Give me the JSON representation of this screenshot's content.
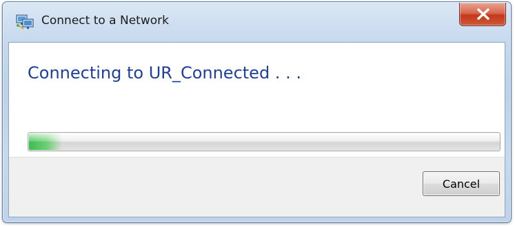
{
  "window": {
    "title": "Connect to a Network",
    "icon": "network-connect-icon",
    "close_icon": "close-icon"
  },
  "main": {
    "heading": "Connecting to UR_Connected . . ."
  },
  "progress": {
    "value_fraction": 0.07,
    "fill_color": "#3cbe50"
  },
  "footer": {
    "cancel_label": "Cancel"
  },
  "colors": {
    "heading_text": "#1e3f9a",
    "close_button": "#c3381c"
  }
}
